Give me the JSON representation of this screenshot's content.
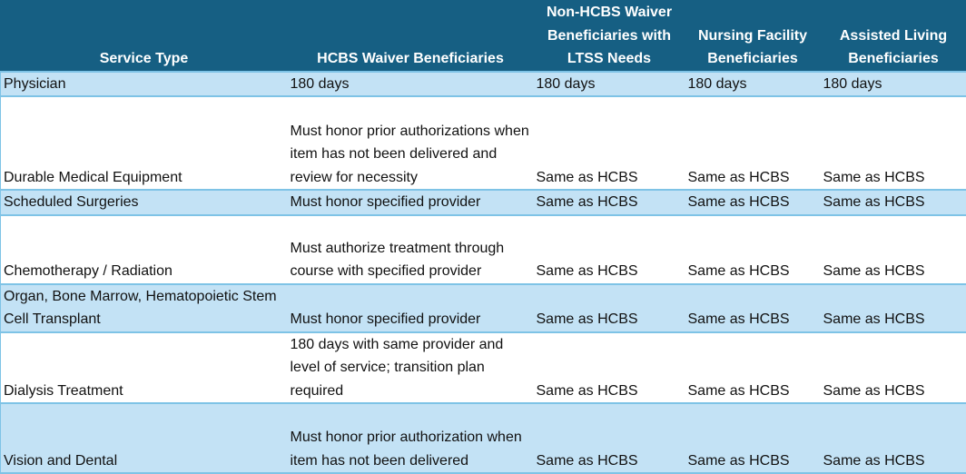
{
  "table": {
    "headers": [
      "Service Type",
      "HCBS Waiver Beneficiaries",
      "Non-HCBS Waiver Beneficiaries with LTSS Needs",
      "Nursing Facility Beneficiaries",
      "Assisted Living Beneficiaries"
    ],
    "rows": [
      [
        "Physician",
        "180 days",
        "180 days",
        "180 days",
        "180 days"
      ],
      [
        "Durable Medical Equipment",
        "Must honor prior authorizations when item has not been delivered and review for necessity",
        "Same as HCBS",
        "Same as HCBS",
        "Same as HCBS"
      ],
      [
        "Scheduled Surgeries",
        "Must honor specified provider",
        "Same as HCBS",
        "Same as HCBS",
        "Same as HCBS"
      ],
      [
        "Chemotherapy / Radiation",
        "Must authorize treatment through course with specified provider",
        "Same as HCBS",
        "Same as HCBS",
        "Same as HCBS"
      ],
      [
        "Organ, Bone Marrow, Hematopoietic Stem Cell Transplant",
        "Must honor specified provider",
        "Same as HCBS",
        "Same as HCBS",
        "Same as HCBS"
      ],
      [
        "Dialysis Treatment",
        "180 days with same provider and level of service; transition plan required",
        "Same as HCBS",
        "Same as HCBS",
        "Same as HCBS"
      ],
      [
        "Vision and Dental",
        "Must honor prior authorization when item has not been delivered",
        "Same as HCBS",
        "Same as HCBS",
        "Same as HCBS"
      ]
    ]
  },
  "colors": {
    "header_bg": "#165f83",
    "header_text": "#ffffff",
    "row_shade": "#c3e2f5",
    "row_plain": "#ffffff",
    "border": "#7ec3e6"
  }
}
